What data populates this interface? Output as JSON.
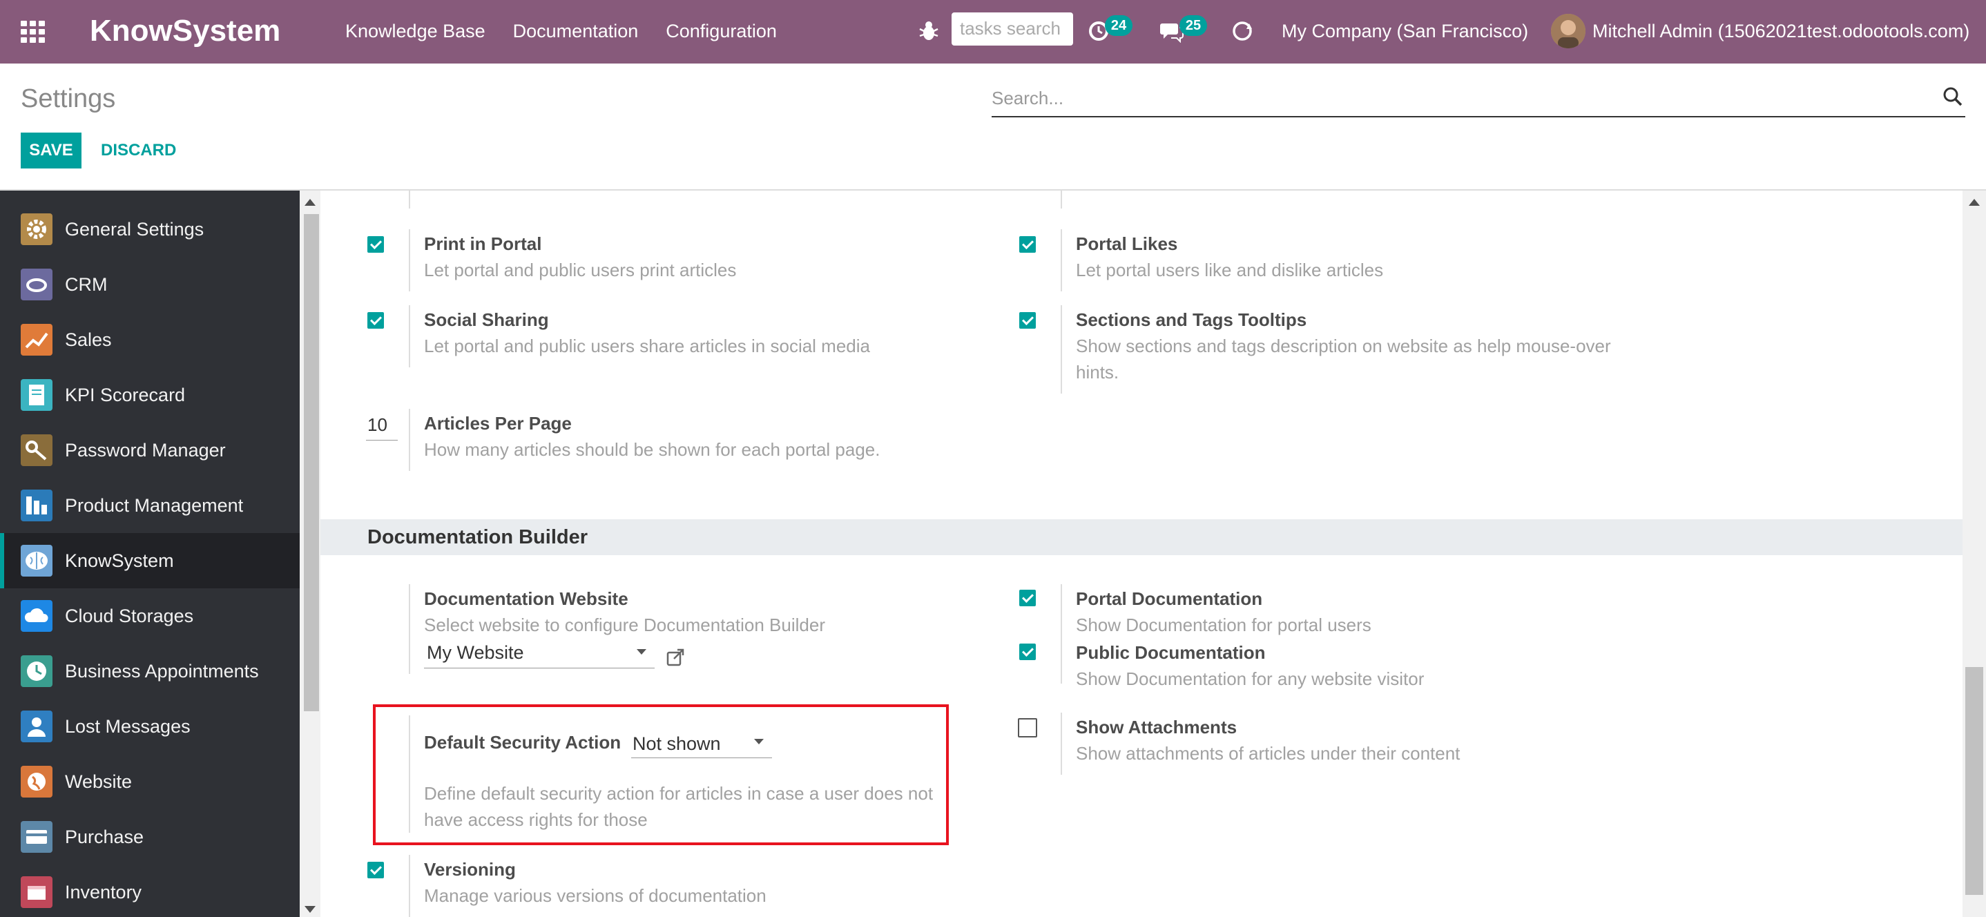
{
  "navbar": {
    "brand": "KnowSystem",
    "menu": [
      "Knowledge Base",
      "Documentation",
      "Configuration"
    ],
    "task_search_placeholder": "tasks search",
    "activity_count": "24",
    "message_count": "25",
    "company": "My Company (San Francisco)",
    "user": "Mitchell Admin (15062021test.odootools.com)",
    "color": "#875a7b"
  },
  "control_panel": {
    "title": "Settings",
    "search_placeholder": "Search...",
    "save_label": "SAVE",
    "discard_label": "DISCARD",
    "accent": "#00a09d"
  },
  "sidebar": {
    "items": [
      {
        "label": "General Settings",
        "icon": "gear-icon",
        "color": "#b38a4a"
      },
      {
        "label": "CRM",
        "icon": "handshake-icon",
        "color": "#6c6a9e"
      },
      {
        "label": "Sales",
        "icon": "chart-line-icon",
        "color": "#e07b39"
      },
      {
        "label": "KPI Scorecard",
        "icon": "scorecard-icon",
        "color": "#3bb4c1"
      },
      {
        "label": "Password Manager",
        "icon": "key-icon",
        "color": "#8a6d3b"
      },
      {
        "label": "Product Management",
        "icon": "product-icon",
        "color": "#2b7bb9"
      },
      {
        "label": "KnowSystem",
        "icon": "brain-icon",
        "color": "#6fa5d6"
      },
      {
        "label": "Cloud Storages",
        "icon": "cloud-icon",
        "color": "#1e88e5"
      },
      {
        "label": "Business Appointments",
        "icon": "clock-icon",
        "color": "#3a9e8f"
      },
      {
        "label": "Lost Messages",
        "icon": "user-icon",
        "color": "#2f7fc1"
      },
      {
        "label": "Website",
        "icon": "globe-icon",
        "color": "#d9773b"
      },
      {
        "label": "Purchase",
        "icon": "card-icon",
        "color": "#5d88a8"
      },
      {
        "label": "Inventory",
        "icon": "box-icon",
        "color": "#c0485a"
      }
    ],
    "active_index": 6
  },
  "settings": {
    "print_portal": {
      "title": "Print in Portal",
      "desc": "Let portal and public users print articles",
      "checked": true
    },
    "portal_likes": {
      "title": "Portal Likes",
      "desc": "Let portal users like and dislike articles",
      "checked": true
    },
    "social_sharing": {
      "title": "Social Sharing",
      "desc": "Let portal and public users share articles in social media",
      "checked": true
    },
    "tooltips": {
      "title": "Sections and Tags Tooltips",
      "desc_line1": "Show sections and tags description on website as help mouse-over",
      "desc_line2": "hints.",
      "checked": true
    },
    "articles_per_page": {
      "title": "Articles Per Page",
      "desc": "How many articles should be shown for each portal page.",
      "value": "10"
    },
    "section_title": "Documentation Builder",
    "doc_website": {
      "title": "Documentation Website",
      "desc": "Select website to configure Documentation Builder",
      "value": "My Website"
    },
    "portal_doc": {
      "title": "Portal Documentation",
      "desc": "Show Documentation for portal users",
      "checked": true
    },
    "public_doc": {
      "title": "Public Documentation",
      "desc": "Show Documentation for any website visitor",
      "checked": true
    },
    "security_action": {
      "title": "Default Security Action",
      "value": "Not shown",
      "desc_line1": "Define default security action for articles in case a user does not",
      "desc_line2": "have access rights for those"
    },
    "attachments": {
      "title": "Show Attachments",
      "desc": "Show attachments of articles under their content",
      "checked": false
    },
    "versioning": {
      "title": "Versioning",
      "desc": "Manage various versions of documentation",
      "checked": true
    }
  }
}
